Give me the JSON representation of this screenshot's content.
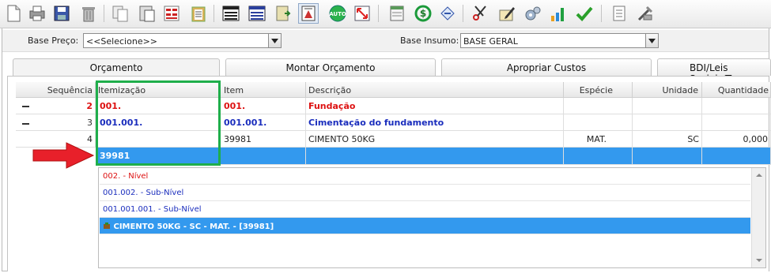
{
  "toolbar": {
    "icons": [
      "new-document-icon",
      "print-icon",
      "save-disk-icon",
      "trash-icon",
      "copy-icon",
      "paste-icon",
      "calculator-icon",
      "clipboard-list-icon",
      "table-lines-icon",
      "table-lines-blue-icon",
      "document-import-icon",
      "report-icon",
      "auto-icon",
      "expand-arrows-icon",
      "spreadsheet-icon",
      "money-recycle-icon",
      "tag-arrow-icon",
      "scissors-check-icon",
      "pen-paper-icon",
      "gears-icon",
      "bar-chart-icon",
      "checkmark-icon",
      "notes-icon",
      "wrench-pen-icon"
    ],
    "auto_label": "AUTO"
  },
  "filters": {
    "base_preco_label": "Base Preço:",
    "base_preco_value": "<<Selecione>>",
    "base_insumo_label": "Base Insumo:",
    "base_insumo_value": "BASE GERAL"
  },
  "tabs": [
    "Orçamento",
    "Montar Orçamento",
    "Apropriar Custos",
    "BDI/Leis Sociais/T"
  ],
  "grid": {
    "headers": [
      "Sequência",
      "Itemização",
      "Item",
      "Descrição",
      "Espécie",
      "Unidade",
      "Quantidade"
    ],
    "rows": [
      {
        "seq": "2",
        "itemizacao": "001.",
        "item": "001.",
        "descricao": "Fundação",
        "especie": "",
        "unidade": "",
        "quantidade": ""
      },
      {
        "seq": "3",
        "itemizacao": "001.001.",
        "item": "001.001.",
        "descricao": "Cimentação do fundamento",
        "especie": "",
        "unidade": "",
        "quantidade": ""
      },
      {
        "seq": "4",
        "itemizacao": "",
        "item": "39981",
        "descricao": "CIMENTO 50KG",
        "especie": "MAT.",
        "unidade": "SC",
        "quantidade": "0,000"
      },
      {
        "seq": "",
        "itemizacao": "39981",
        "item": "",
        "descricao": "",
        "especie": "",
        "unidade": "",
        "quantidade": ""
      }
    ]
  },
  "dropdown": {
    "items": [
      "002. - Nível",
      "001.002. - Sub-Nível",
      "001.001.001. - Sub-Nível",
      "CIMENTO 50KG - SC - MAT. - [39981]"
    ]
  },
  "colors": {
    "selection": "#3399ee",
    "level_red": "#dd1111",
    "level_blue": "#1a2dbd",
    "highlight_box": "#1fae4b",
    "arrow": "#e8202a"
  }
}
